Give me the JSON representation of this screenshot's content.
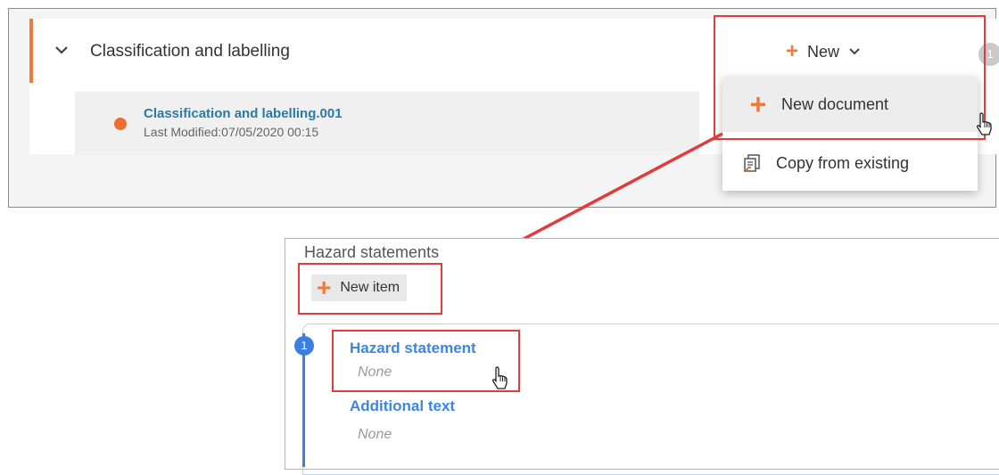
{
  "top": {
    "section_title": "Classification and labelling",
    "new_label": "New",
    "badge_count": "1",
    "document": {
      "title": "Classification and labelling.001",
      "modified": "Last Modified:07/05/2020 00:15"
    },
    "dropdown": [
      {
        "label": "New document",
        "icon": "plus-icon"
      },
      {
        "label": "Copy from existing",
        "icon": "copy-document-icon"
      }
    ]
  },
  "bottom": {
    "title": "Hazard statements",
    "new_item_label": "New item",
    "item_number": "1",
    "fields": [
      {
        "label": "Hazard statement",
        "value": "None"
      },
      {
        "label": "Additional text",
        "value": "None"
      }
    ]
  },
  "colors": {
    "accent": "#f07a3b",
    "link": "#2a7aa8",
    "highlight": "#e03c3c",
    "blue": "#3d7fe0"
  }
}
